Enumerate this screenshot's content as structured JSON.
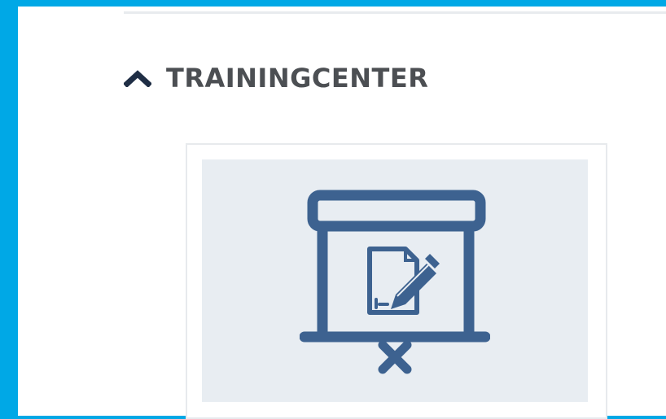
{
  "colors": {
    "frame": "#00a8e6",
    "panel_background": "#ffffff",
    "heading_text": "#4c4f53",
    "thumbnail_background": "#e8edf2",
    "icon": "#3d6290",
    "divider": "#e8ebee"
  },
  "section": {
    "title": "TRAININGCENTER",
    "toggle_icon": "chevron-up-icon",
    "expanded": true
  },
  "card": {
    "icon": "presentation-board-with-document-and-pen-icon"
  }
}
